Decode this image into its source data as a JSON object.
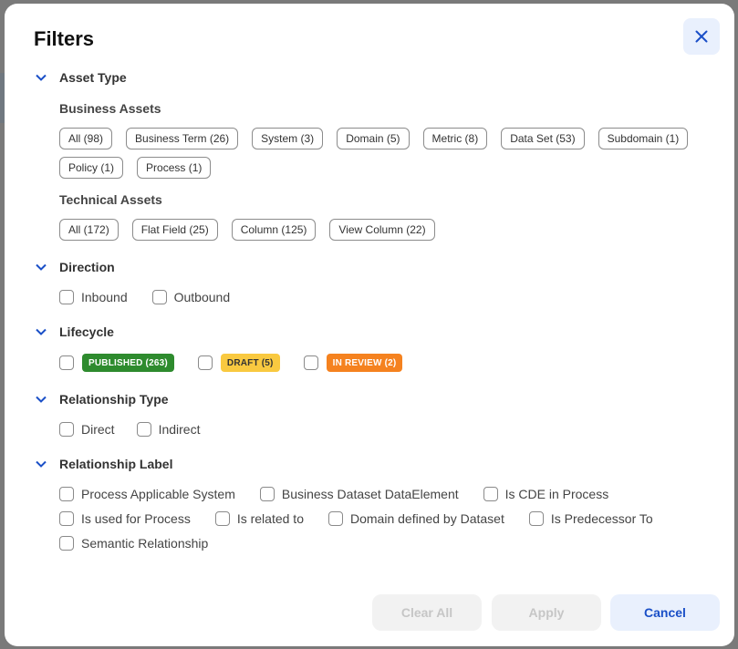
{
  "title": "Filters",
  "close_icon": "close-icon",
  "colors": {
    "accent": "#1a4fc7",
    "published": "#2e8b2e",
    "draft": "#f9c940",
    "in_review": "#f5821f"
  },
  "asset_type": {
    "label": "Asset Type",
    "business": {
      "label": "Business Assets",
      "chips": [
        "All (98)",
        "Business Term (26)",
        "System (3)",
        "Domain (5)",
        "Metric (8)",
        "Data Set (53)",
        "Subdomain (1)",
        "Policy (1)",
        "Process (1)"
      ]
    },
    "technical": {
      "label": "Technical Assets",
      "chips": [
        "All (172)",
        "Flat Field (25)",
        "Column (125)",
        "View Column (22)"
      ]
    }
  },
  "direction": {
    "label": "Direction",
    "options": [
      "Inbound",
      "Outbound"
    ]
  },
  "lifecycle": {
    "label": "Lifecycle",
    "options": [
      "PUBLISHED (263)",
      "DRAFT (5)",
      "IN REVIEW (2)"
    ]
  },
  "relationship_type": {
    "label": "Relationship Type",
    "options": [
      "Direct",
      "Indirect"
    ]
  },
  "relationship_label": {
    "label": "Relationship Label",
    "options": [
      "Process Applicable System",
      "Business Dataset DataElement",
      "Is CDE in Process",
      "Is used for Process",
      "Is related to",
      "Domain defined by Dataset",
      "Is Predecessor To",
      "Semantic Relationship"
    ]
  },
  "footer": {
    "clear_all": "Clear All",
    "apply": "Apply",
    "cancel": "Cancel"
  }
}
